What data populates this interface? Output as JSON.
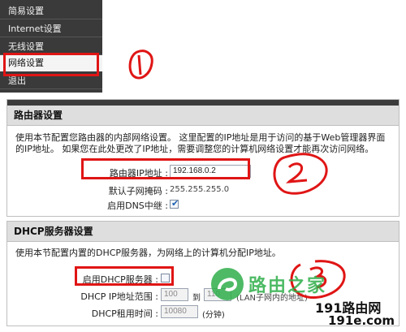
{
  "menu": {
    "items": [
      {
        "label": "简易设置"
      },
      {
        "label": "Internet设置"
      },
      {
        "label": "无线设置"
      },
      {
        "label": "网络设置"
      },
      {
        "label": "退出"
      }
    ],
    "active_index": 3
  },
  "router": {
    "title": "路由器设置",
    "description": "使用本节配置您路由器的内部网络设置。 这里配置的IP地址是用于访问的基于Web管理器界面的IP地址。 如果您在此处更改了IP地址，需要调整您的计算机网络设置才能再次访问网络。",
    "ip_label": "路由器IP地址 :",
    "ip_value": "192.168.0.2",
    "mask_label": "默认子网掩码 :",
    "mask_value": "255.255.255.0",
    "dns_label": "启用DNS中继 :",
    "dns_checked": true
  },
  "dhcp": {
    "title": "DHCP服务器设置",
    "description": "使用本节配置内置的DHCP服务器，为网络上的计算机分配IP地址。",
    "enable_label": "启用DHCP服务器 :",
    "enable_checked": false,
    "range_label": "DHCP IP地址范围 :",
    "range_start": "100",
    "range_to": "到",
    "range_end": "110",
    "range_note": "(LAN子网内的地址)",
    "lease_label": "DHCP租用时间 :",
    "lease_value": "10080",
    "lease_unit": "(分钟)"
  },
  "annotations": [
    "①",
    "②",
    "③"
  ],
  "watermark": {
    "logo_text": "路由之家",
    "site1": "191路由网",
    "site2": "191e.com"
  },
  "colors": {
    "highlight_red": "#e01515",
    "menu_bg": "#3a3a3a",
    "section_header_bg": "#dedede",
    "watermark_green": "#2fae4a"
  }
}
